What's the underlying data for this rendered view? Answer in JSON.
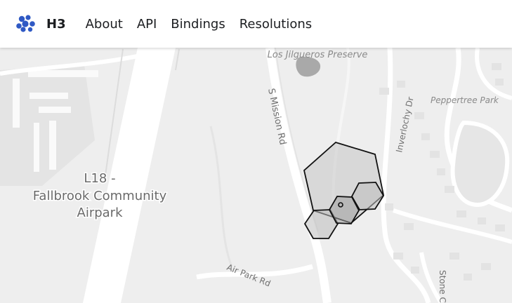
{
  "navbar": {
    "brand": {
      "title": "H3",
      "logo_icon": "h3-hexagon-cluster-icon",
      "logo_color": "#2f59c4"
    },
    "links": [
      {
        "label": "About"
      },
      {
        "label": "API"
      },
      {
        "label": "Bindings"
      },
      {
        "label": "Resolutions"
      }
    ]
  },
  "map": {
    "labels": {
      "preserve": "Los Jilgueros Preserve",
      "mission_rd": "S Mission Rd",
      "inverlochy": "Inverlochy Dr",
      "peppertree": "Peppertree Park",
      "airport_line1": "L18 -",
      "airport_line2": "Fallbrook Community",
      "airport_line3": "Airpark",
      "air_park_rd": "Air Park Rd",
      "stone": "Stone C"
    },
    "colors": {
      "background": "#eeeeee",
      "road": "#ffffff",
      "hex_fill": "#bdbdbd",
      "hex_stroke": "#111111",
      "water": "#a9a9a9"
    }
  }
}
